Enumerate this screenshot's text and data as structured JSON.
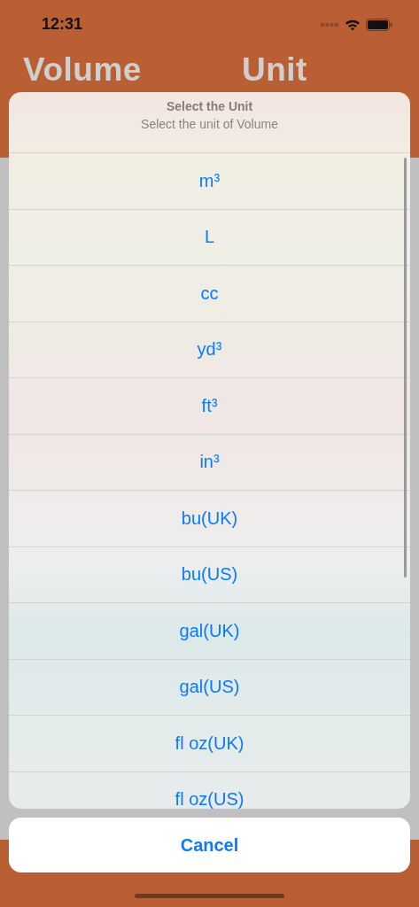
{
  "status_bar": {
    "time": "12:31"
  },
  "header": {
    "titles": [
      "Volume",
      "Unit"
    ]
  },
  "action_sheet": {
    "title": "Select the Unit",
    "message": "Select the unit of Volume",
    "options": [
      "m³",
      "L",
      "cc",
      "yd³",
      "ft³",
      "in³",
      "bu(UK)",
      "bu(US)",
      "gal(UK)",
      "gal(US)",
      "fl oz(UK)",
      "fl oz(US)"
    ],
    "cancel": "Cancel"
  }
}
